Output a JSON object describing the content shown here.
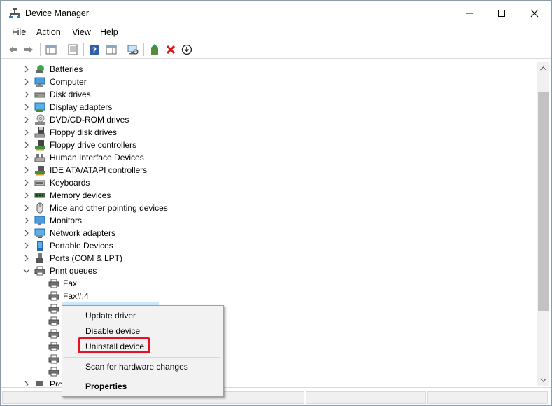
{
  "window": {
    "title": "Device Manager"
  },
  "menubar": {
    "items": [
      "File",
      "Action",
      "View",
      "Help"
    ]
  },
  "toolbar": {
    "buttons": [
      "back-icon",
      "forward-icon",
      "show-hide-console-tree-icon",
      "properties-icon",
      "help-icon",
      "action-pane-icon",
      "scan-hardware-icon",
      "update-driver-icon",
      "uninstall-icon",
      "disable-icon"
    ]
  },
  "tree": {
    "categories": [
      {
        "label": "Batteries",
        "icon": "battery-icon"
      },
      {
        "label": "Computer",
        "icon": "computer-icon"
      },
      {
        "label": "Disk drives",
        "icon": "disk-drive-icon"
      },
      {
        "label": "Display adapters",
        "icon": "display-adapter-icon"
      },
      {
        "label": "DVD/CD-ROM drives",
        "icon": "dvd-drive-icon"
      },
      {
        "label": "Floppy disk drives",
        "icon": "floppy-drive-icon"
      },
      {
        "label": "Floppy drive controllers",
        "icon": "floppy-controller-icon"
      },
      {
        "label": "Human Interface Devices",
        "icon": "hid-icon"
      },
      {
        "label": "IDE ATA/ATAPI controllers",
        "icon": "ide-controller-icon"
      },
      {
        "label": "Keyboards",
        "icon": "keyboard-icon"
      },
      {
        "label": "Memory devices",
        "icon": "memory-icon"
      },
      {
        "label": "Mice and other pointing devices",
        "icon": "mouse-icon"
      },
      {
        "label": "Monitors",
        "icon": "monitor-icon"
      },
      {
        "label": "Network adapters",
        "icon": "network-adapter-icon"
      },
      {
        "label": "Portable Devices",
        "icon": "portable-device-icon"
      },
      {
        "label": "Ports (COM & LPT)",
        "icon": "port-icon"
      },
      {
        "label": "Print queues",
        "icon": "printer-icon",
        "expanded": true
      }
    ],
    "print_queue_children": [
      "Fax",
      "Fax#:4"
    ],
    "partial_last_label": "Pro"
  },
  "context_menu": {
    "items": [
      "Update driver",
      "Disable device",
      "Uninstall device",
      "Scan for hardware changes",
      "Properties"
    ],
    "highlight_color": "#e81123"
  },
  "colors": {
    "selection": "#cce8ff",
    "accent_red": "#e81123"
  }
}
